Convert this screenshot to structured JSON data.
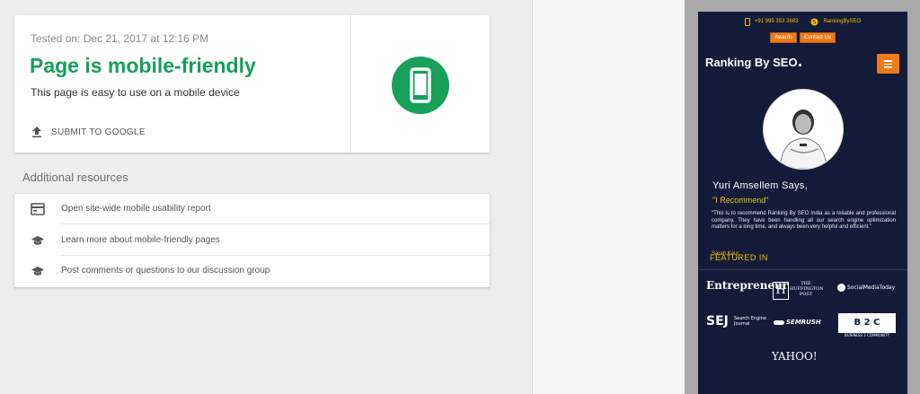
{
  "result": {
    "tested_on": "Tested on: Dec 21, 2017 at 12:16 PM",
    "headline": "Page is mobile-friendly",
    "subtext": "This page is easy to use on a mobile device",
    "submit_label": "SUBMIT TO GOOGLE",
    "status_color": "#16a05a"
  },
  "resources": {
    "title": "Additional resources",
    "items": [
      {
        "label": "Open site-wide mobile usability report",
        "icon": "report-card-icon"
      },
      {
        "label": "Learn more about mobile-friendly pages",
        "icon": "graduation-cap-icon"
      },
      {
        "label": "Post comments or questions to our discussion group",
        "icon": "graduation-cap-icon"
      }
    ]
  },
  "preview": {
    "phone": "+91 995 353 2683",
    "skype": "RankingBySEO",
    "buttons": [
      "Awards",
      "Contact Us"
    ],
    "logo": "Ranking By SEO",
    "testimonial_name": "Yuri Amsellem Says,",
    "testimonial_tag": "\"I Recommend\"",
    "quote": "\"This is to recommend Ranking By SEO India as a reliable and professional company. They have been handling all our search engine optimization matters for a long time, and always been very helpful and efficient.\"",
    "author": "Sarah Kaur",
    "featured_title": "FEATURED IN",
    "brands": {
      "entrepreneur": "Entrepreneur",
      "huffington_h": "H",
      "huffington_text": "THE HUFFINGTON POST",
      "socialmedia": "SocialMediaToday",
      "sej": "SEJ",
      "sej_sub": "Search Engine Journal",
      "semrush": "SEMRUSH",
      "b2c": "B 2 C",
      "b2c_sub": "BUSINESS 2 COMMUNITY",
      "yahoo": "YAHOO!"
    },
    "accent": "#ee7a1a",
    "highlight": "#f0c000",
    "background": "#141b39"
  }
}
